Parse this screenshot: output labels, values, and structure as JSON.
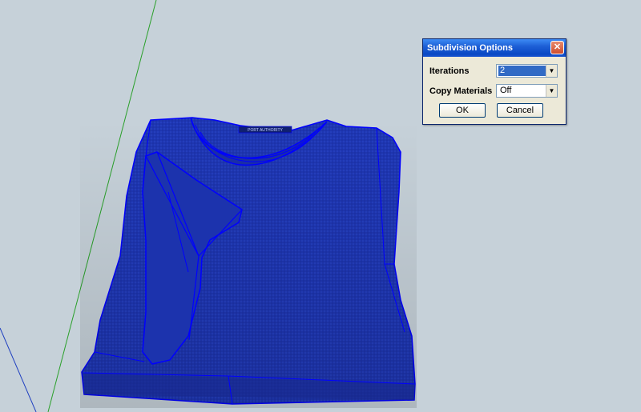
{
  "dialog": {
    "title": "Subdivision Options",
    "close_glyph": "✕",
    "iterations_label": "Iterations",
    "iterations_value": "2",
    "copy_materials_label": "Copy Materials",
    "copy_materials_value": "Off",
    "ok_label": "OK",
    "cancel_label": "Cancel"
  },
  "scene": {
    "shirt_tag_text": "PORT AUTHORITY",
    "shirt_color": "#1f3bbf",
    "edge_color": "#0000ff",
    "background_color": "#c6d1d9",
    "green_axis_color": "#2aa02a",
    "blue_axis_color": "#1f3fbf"
  }
}
